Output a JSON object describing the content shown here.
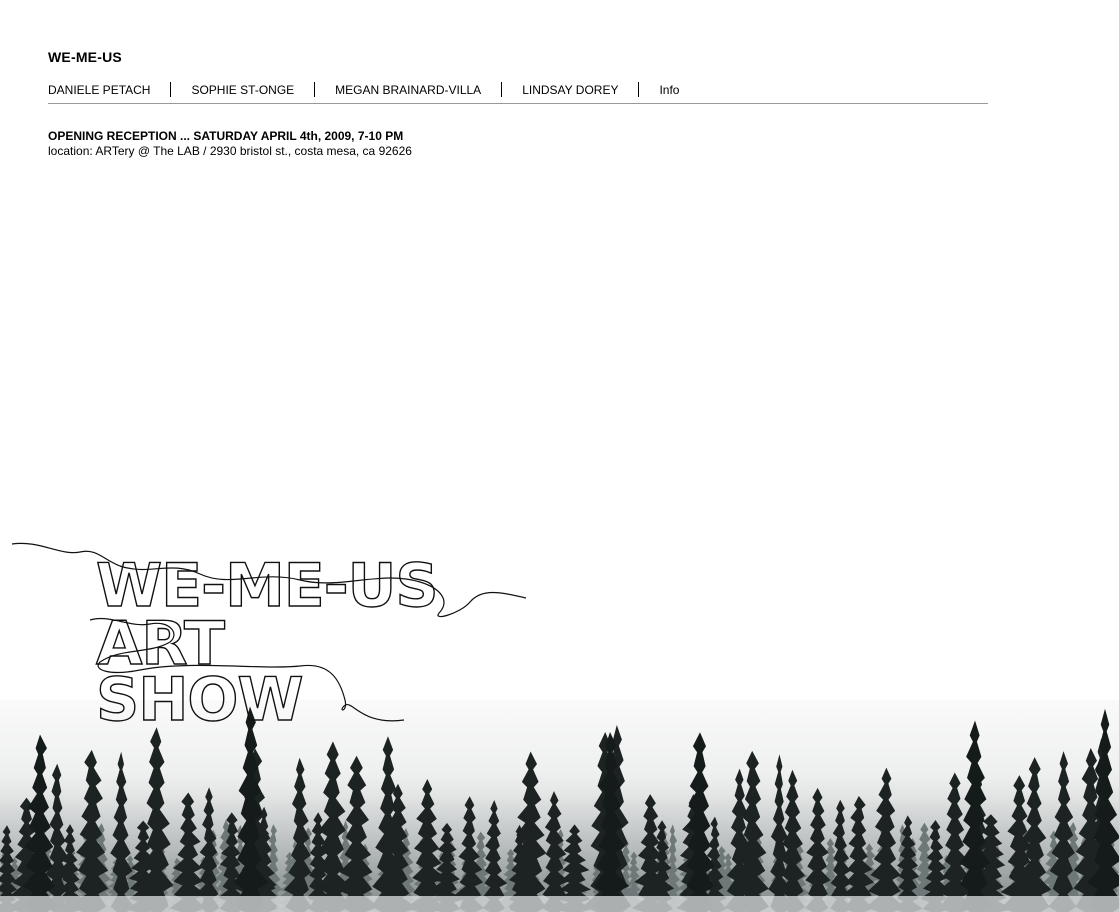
{
  "header": {
    "site_title": "WE-ME-US"
  },
  "nav": {
    "items": [
      {
        "label": "DANIELE PETACH"
      },
      {
        "label": "SOPHIE ST-ONGE"
      },
      {
        "label": "MEGAN BRAINARD-VILLA"
      },
      {
        "label": "LINDSAY DOREY"
      },
      {
        "label": "Info"
      }
    ]
  },
  "event": {
    "reception": "OPENING RECEPTION ... SATURDAY APRIL 4th, 2009, 7-10 PM",
    "location": "location: ARTery @ The LAB / 2930 bristol st., costa mesa, ca 92626"
  },
  "logo": {
    "line1": "WE-ME-US",
    "line2": "ART",
    "line3": "SHOW"
  }
}
